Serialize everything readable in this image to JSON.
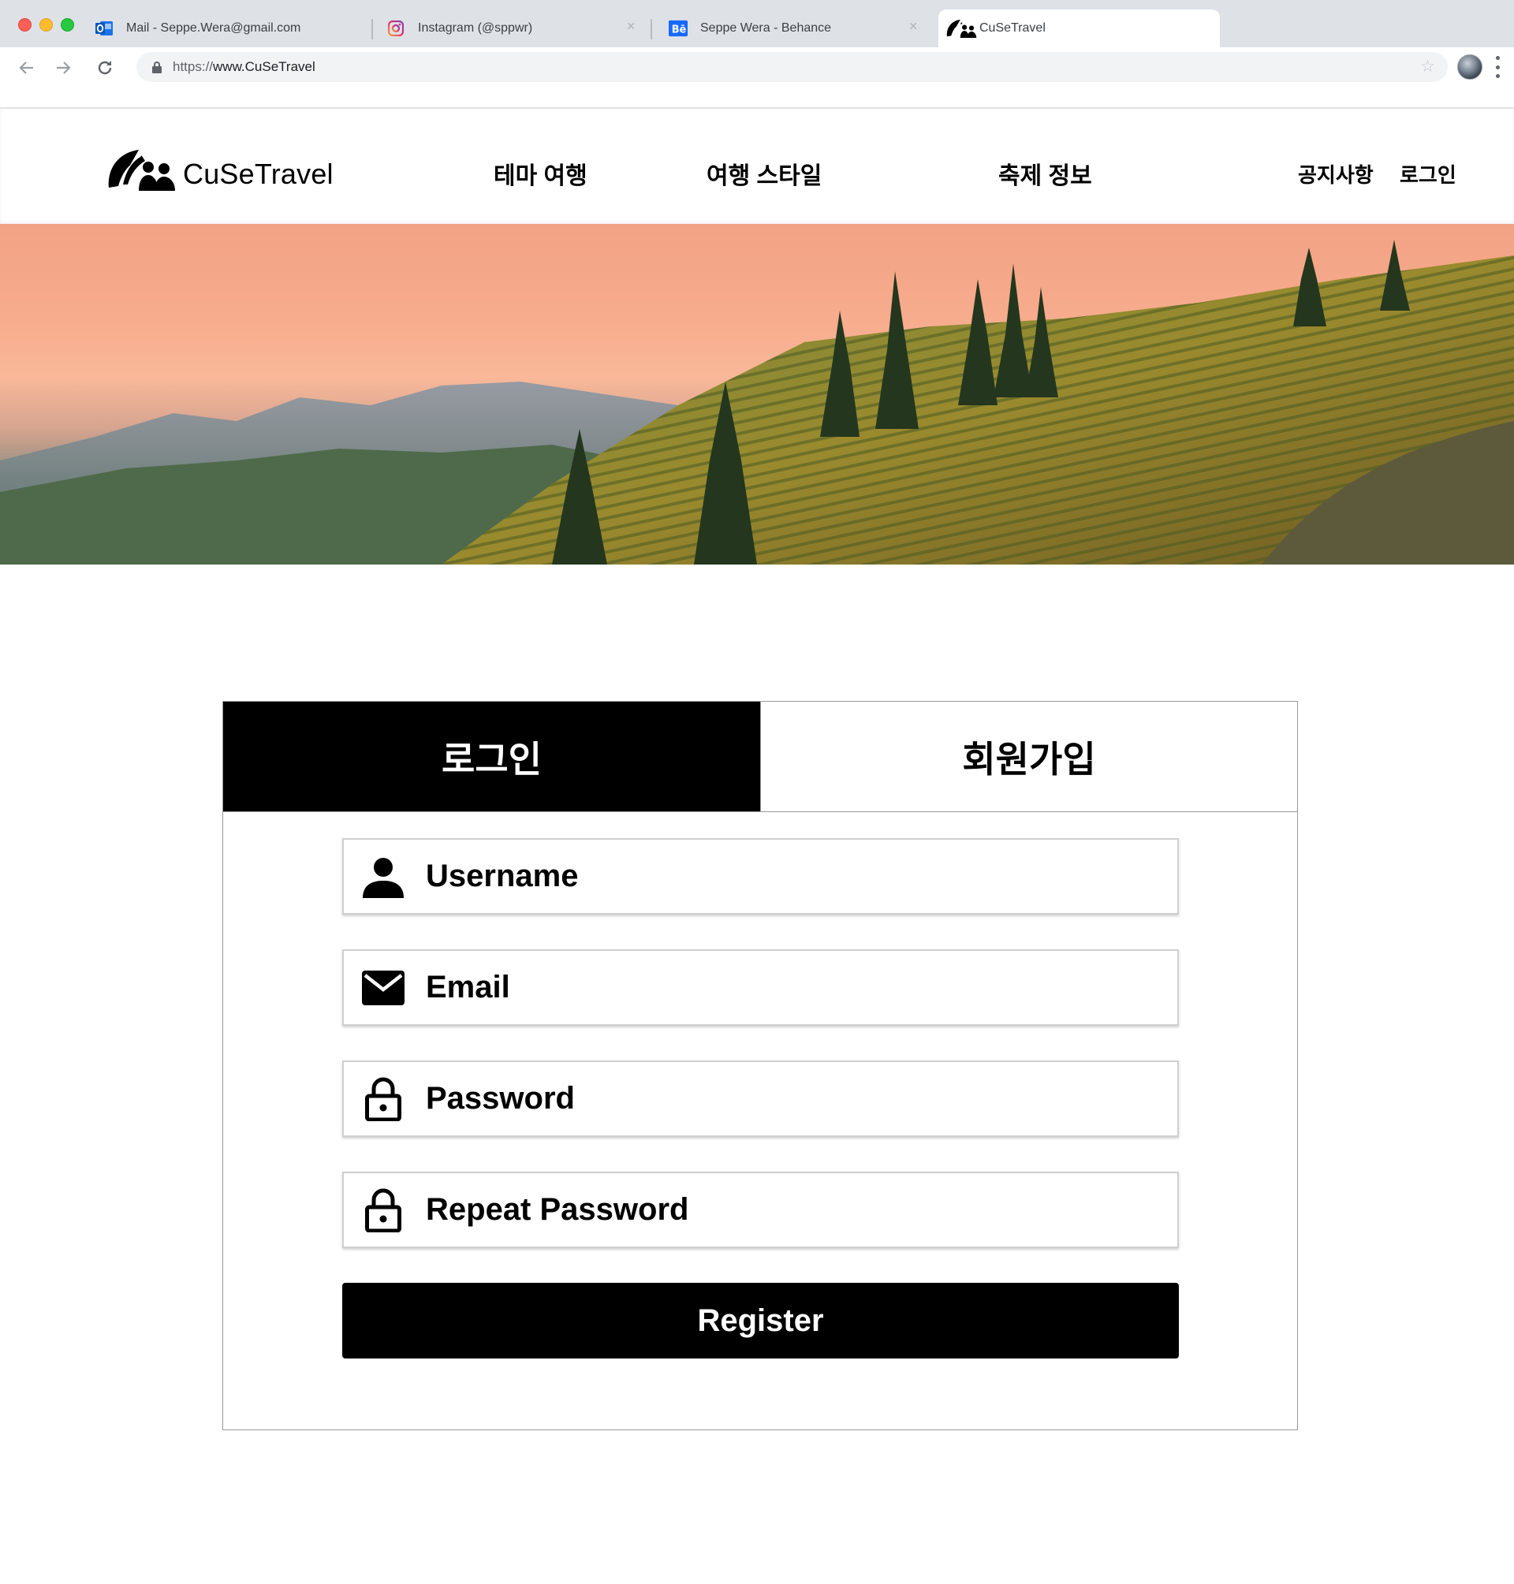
{
  "browser": {
    "tabs": [
      {
        "title": "Mail - Seppe.Wera@gmail.com",
        "icon": "outlook-icon"
      },
      {
        "title": "Instagram (@sppwr)",
        "icon": "instagram-icon"
      },
      {
        "title": "Seppe Wera - Behance",
        "icon": "behance-icon"
      },
      {
        "title": "CuSeTravel",
        "icon": "cusetravel-logo-icon"
      }
    ],
    "url_scheme": "https://",
    "url_host": "www.CuSeTravel"
  },
  "site": {
    "brand": "CuSeTravel",
    "nav": [
      "테마 여행",
      "여행 스타일",
      "축제 정보"
    ],
    "utility": [
      "공지사항",
      "로그인"
    ]
  },
  "form": {
    "tabs": {
      "login": "로그인",
      "signup": "회원가입"
    },
    "active_tab": "login",
    "fields": [
      {
        "placeholder": "Username",
        "icon": "user-icon"
      },
      {
        "placeholder": "Email",
        "icon": "envelope-icon"
      },
      {
        "placeholder": "Password",
        "icon": "lock-icon"
      },
      {
        "placeholder": "Repeat Password",
        "icon": "lock-icon"
      }
    ],
    "submit_label": "Register"
  },
  "colors": {
    "primary": "#000000",
    "tabstrip": "#dee1e6",
    "omnibox": "#f1f3f4"
  }
}
